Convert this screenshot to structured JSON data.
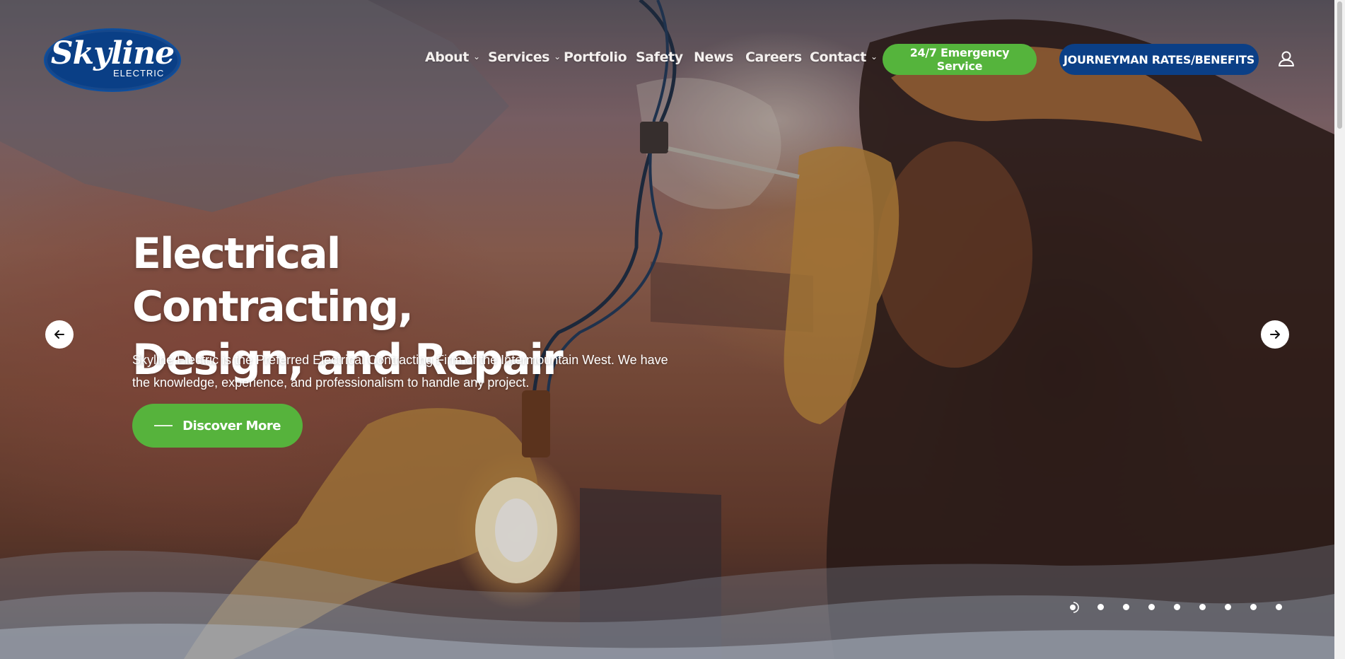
{
  "brand": {
    "logo_name": "Skyline",
    "logo_sub": "ELECTRIC"
  },
  "nav": {
    "items": [
      {
        "label": "About",
        "has_dropdown": true
      },
      {
        "label": "Services",
        "has_dropdown": true
      },
      {
        "label": "Portfolio",
        "has_dropdown": false
      },
      {
        "label": "Safety",
        "has_dropdown": false
      },
      {
        "label": "News",
        "has_dropdown": false
      },
      {
        "label": "Careers",
        "has_dropdown": false
      },
      {
        "label": "Contact",
        "has_dropdown": true
      }
    ],
    "dropdown_icon": "chevron-down-icon",
    "emergency_label": "24/7 Emergency Service",
    "journeyman_label": "JOURNEYMAN RATES/BENEFITS",
    "account_icon": "user-icon"
  },
  "hero": {
    "headline_line1": "Electrical Contracting,",
    "headline_line2": "Design, and Repair",
    "description_line1": "Skyline Electric is the Preferred Electrical Contracting Firm of the Intermountain West. We have",
    "description_line2": "the knowledge, experience, and professionalism to handle any project.",
    "cta_label": "Discover More",
    "prev_icon": "arrow-left-icon",
    "next_icon": "arrow-right-icon"
  },
  "slider": {
    "slide_count": 9,
    "active_index": 0
  },
  "colors": {
    "brand_blue": "#0b3f86",
    "brand_green": "#56b33c",
    "white": "#ffffff"
  }
}
